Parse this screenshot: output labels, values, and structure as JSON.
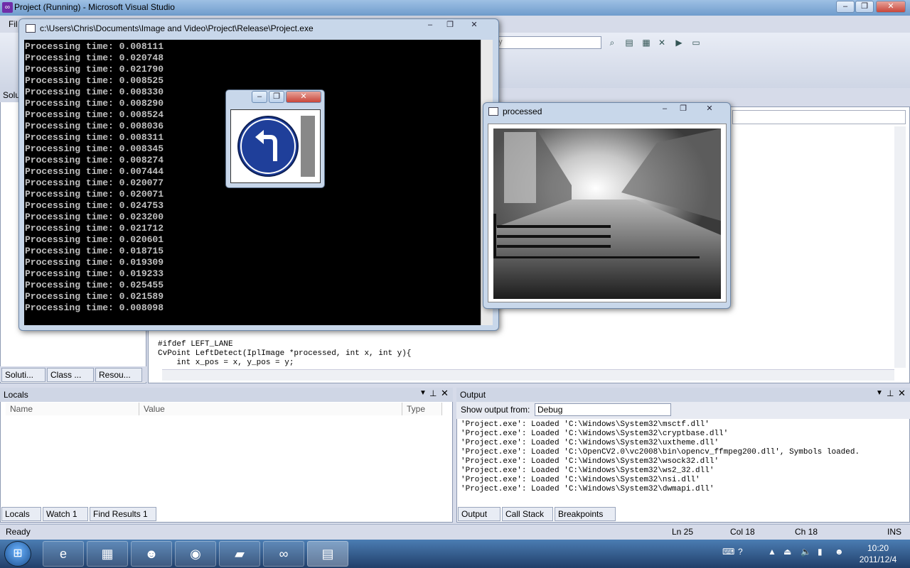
{
  "vs": {
    "title": "Project (Running) - Microsoft Visual Studio",
    "menu_fragment": "Fil",
    "toolbar_combo_fragment": "ny",
    "sol_header_fragment": "Solu",
    "sol_tabs": [
      "Soluti...",
      "Class ...",
      "Resou..."
    ]
  },
  "editor": {
    "lines": [
      "#ifdef LEFT_LANE",
      "CvPoint LeftDetect(IplImage *processed, int x, int y){",
      "    int x_pos = x, y_pos = y;"
    ]
  },
  "console": {
    "title": "c:\\Users\\Chris\\Documents\\Image and Video\\Project\\Release\\Project.exe",
    "label": "Processing time: ",
    "values": [
      "0.008111",
      "0.020748",
      "0.021790",
      "0.008525",
      "0.008330",
      "0.008290",
      "0.008524",
      "0.008036",
      "0.008311",
      "0.008345",
      "0.008274",
      "0.007444",
      "0.020077",
      "0.020071",
      "0.024753",
      "0.023200",
      "0.021712",
      "0.020601",
      "0.018715",
      "0.019309",
      "0.019233",
      "0.025455",
      "0.021589",
      "0.008098"
    ]
  },
  "processed": {
    "title": "processed"
  },
  "locals": {
    "title": "Locals",
    "columns": [
      "Name",
      "Value",
      "Type"
    ],
    "tabs": [
      "Locals",
      "Watch 1",
      "Find Results 1"
    ]
  },
  "output": {
    "title": "Output",
    "show_from_label": "Show output from:",
    "show_from_value": "Debug",
    "lines": [
      "'Project.exe': Loaded 'C:\\Windows\\System32\\msctf.dll'",
      "'Project.exe': Loaded 'C:\\Windows\\System32\\cryptbase.dll'",
      "'Project.exe': Loaded 'C:\\Windows\\System32\\uxtheme.dll'",
      "'Project.exe': Loaded 'C:\\OpenCV2.0\\vc2008\\bin\\opencv_ffmpeg200.dll', Symbols loaded.",
      "'Project.exe': Loaded 'C:\\Windows\\System32\\wsock32.dll'",
      "'Project.exe': Loaded 'C:\\Windows\\System32\\ws2_32.dll'",
      "'Project.exe': Loaded 'C:\\Windows\\System32\\nsi.dll'",
      "'Project.exe': Loaded 'C:\\Windows\\System32\\dwmapi.dll'"
    ],
    "tabs": [
      "Output",
      "Call Stack",
      "Breakpoints"
    ]
  },
  "status": {
    "ready": "Ready",
    "ln": "Ln 25",
    "col": "Col 18",
    "ch": "Ch 18",
    "ins": "INS"
  },
  "taskbar": {
    "time": "10:20",
    "date": "2011/12/4"
  },
  "colors": {
    "console_bg": "#000000",
    "console_text": "#c0c0c0",
    "sign_blue": "#1f3f9a"
  }
}
